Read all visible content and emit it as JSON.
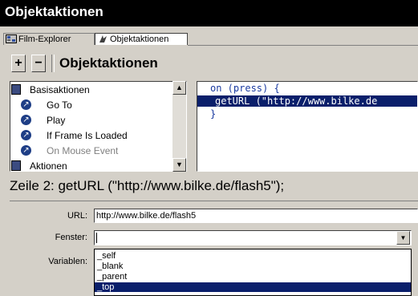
{
  "window": {
    "title": "Objektaktionen"
  },
  "tabs": [
    {
      "label": "Film-Explorer",
      "icon": "film-explorer-icon"
    },
    {
      "label": "Objektaktionen",
      "icon": "object-actions-icon"
    }
  ],
  "toolbar": {
    "add_label": "+",
    "remove_label": "−",
    "title": "Objektaktionen"
  },
  "action_list": {
    "items": [
      {
        "label": "Basisaktionen",
        "type": "category",
        "icon": "book-icon"
      },
      {
        "label": "Go To",
        "type": "action",
        "icon": "action-arrow-icon"
      },
      {
        "label": "Play",
        "type": "action",
        "icon": "action-arrow-icon"
      },
      {
        "label": "If Frame Is Loaded",
        "type": "action",
        "icon": "action-arrow-icon"
      },
      {
        "label": "On Mouse Event",
        "type": "action",
        "icon": "action-arrow-icon",
        "disabled": true
      },
      {
        "label": "Aktionen",
        "type": "category",
        "icon": "book-icon"
      }
    ]
  },
  "script": {
    "lines": [
      "on (press) {",
      "getURL (\"http://www.bilke.de",
      "}"
    ],
    "selected_line": 2
  },
  "statement": {
    "text": "Zeile 2: getURL (\"http://www.bilke.de/flash5\");"
  },
  "params": {
    "url_label": "URL:",
    "url_value": "http://www.bilke.de/flash5",
    "window_label": "Fenster:",
    "window_value": "",
    "variables_label": "Variablen:"
  },
  "window_options": [
    {
      "label": "_self"
    },
    {
      "label": "_blank"
    },
    {
      "label": "_parent"
    },
    {
      "label": "_top",
      "selected": true
    }
  ],
  "colors": {
    "titlebar": "#000000",
    "selection": "#0a1f6b",
    "code_text": "#1a3aa0"
  }
}
